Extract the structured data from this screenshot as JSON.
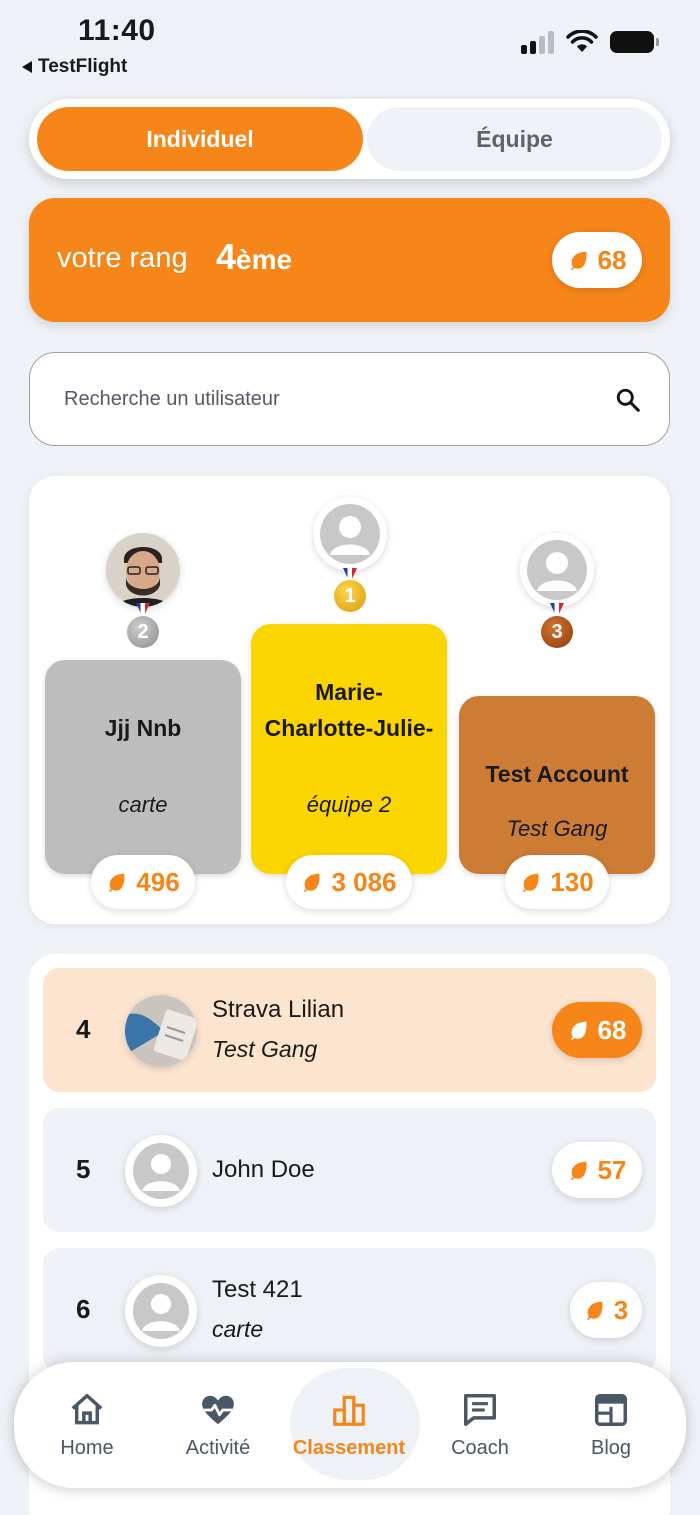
{
  "status_bar": {
    "time": "11:40",
    "back_app": "TestFlight"
  },
  "toggle": {
    "individual": "Individuel",
    "team": "Équipe"
  },
  "rank": {
    "label": "votre rang",
    "number": "4",
    "suffix": "ème",
    "points": "68"
  },
  "search": {
    "placeholder": "Recherche un utilisateur"
  },
  "podium": [
    {
      "place": "2",
      "name": "Jjj Nnb",
      "team": "carte",
      "points": "496"
    },
    {
      "place": "1",
      "name": "Marie-Charlotte-Julie-",
      "team": "équipe 2",
      "points": "3 086"
    },
    {
      "place": "3",
      "name": "Test Account",
      "team": "Test Gang",
      "points": "130"
    }
  ],
  "leaderboard": [
    {
      "rank": "4",
      "name": "Strava Lilian",
      "team": "Test Gang",
      "points": "68"
    },
    {
      "rank": "5",
      "name": "John Doe",
      "team": "",
      "points": "57"
    },
    {
      "rank": "6",
      "name": "Test 421",
      "team": "carte",
      "points": "3"
    }
  ],
  "nav": {
    "home": "Home",
    "activity": "Activité",
    "ranking": "Classement",
    "coach": "Coach",
    "blog": "Blog"
  },
  "colors": {
    "accent": "#f7861a",
    "gold": "#fbd500",
    "silver": "#bdbdbd",
    "bronze": "#cc7c34",
    "highlight_row": "#fce4cf"
  }
}
